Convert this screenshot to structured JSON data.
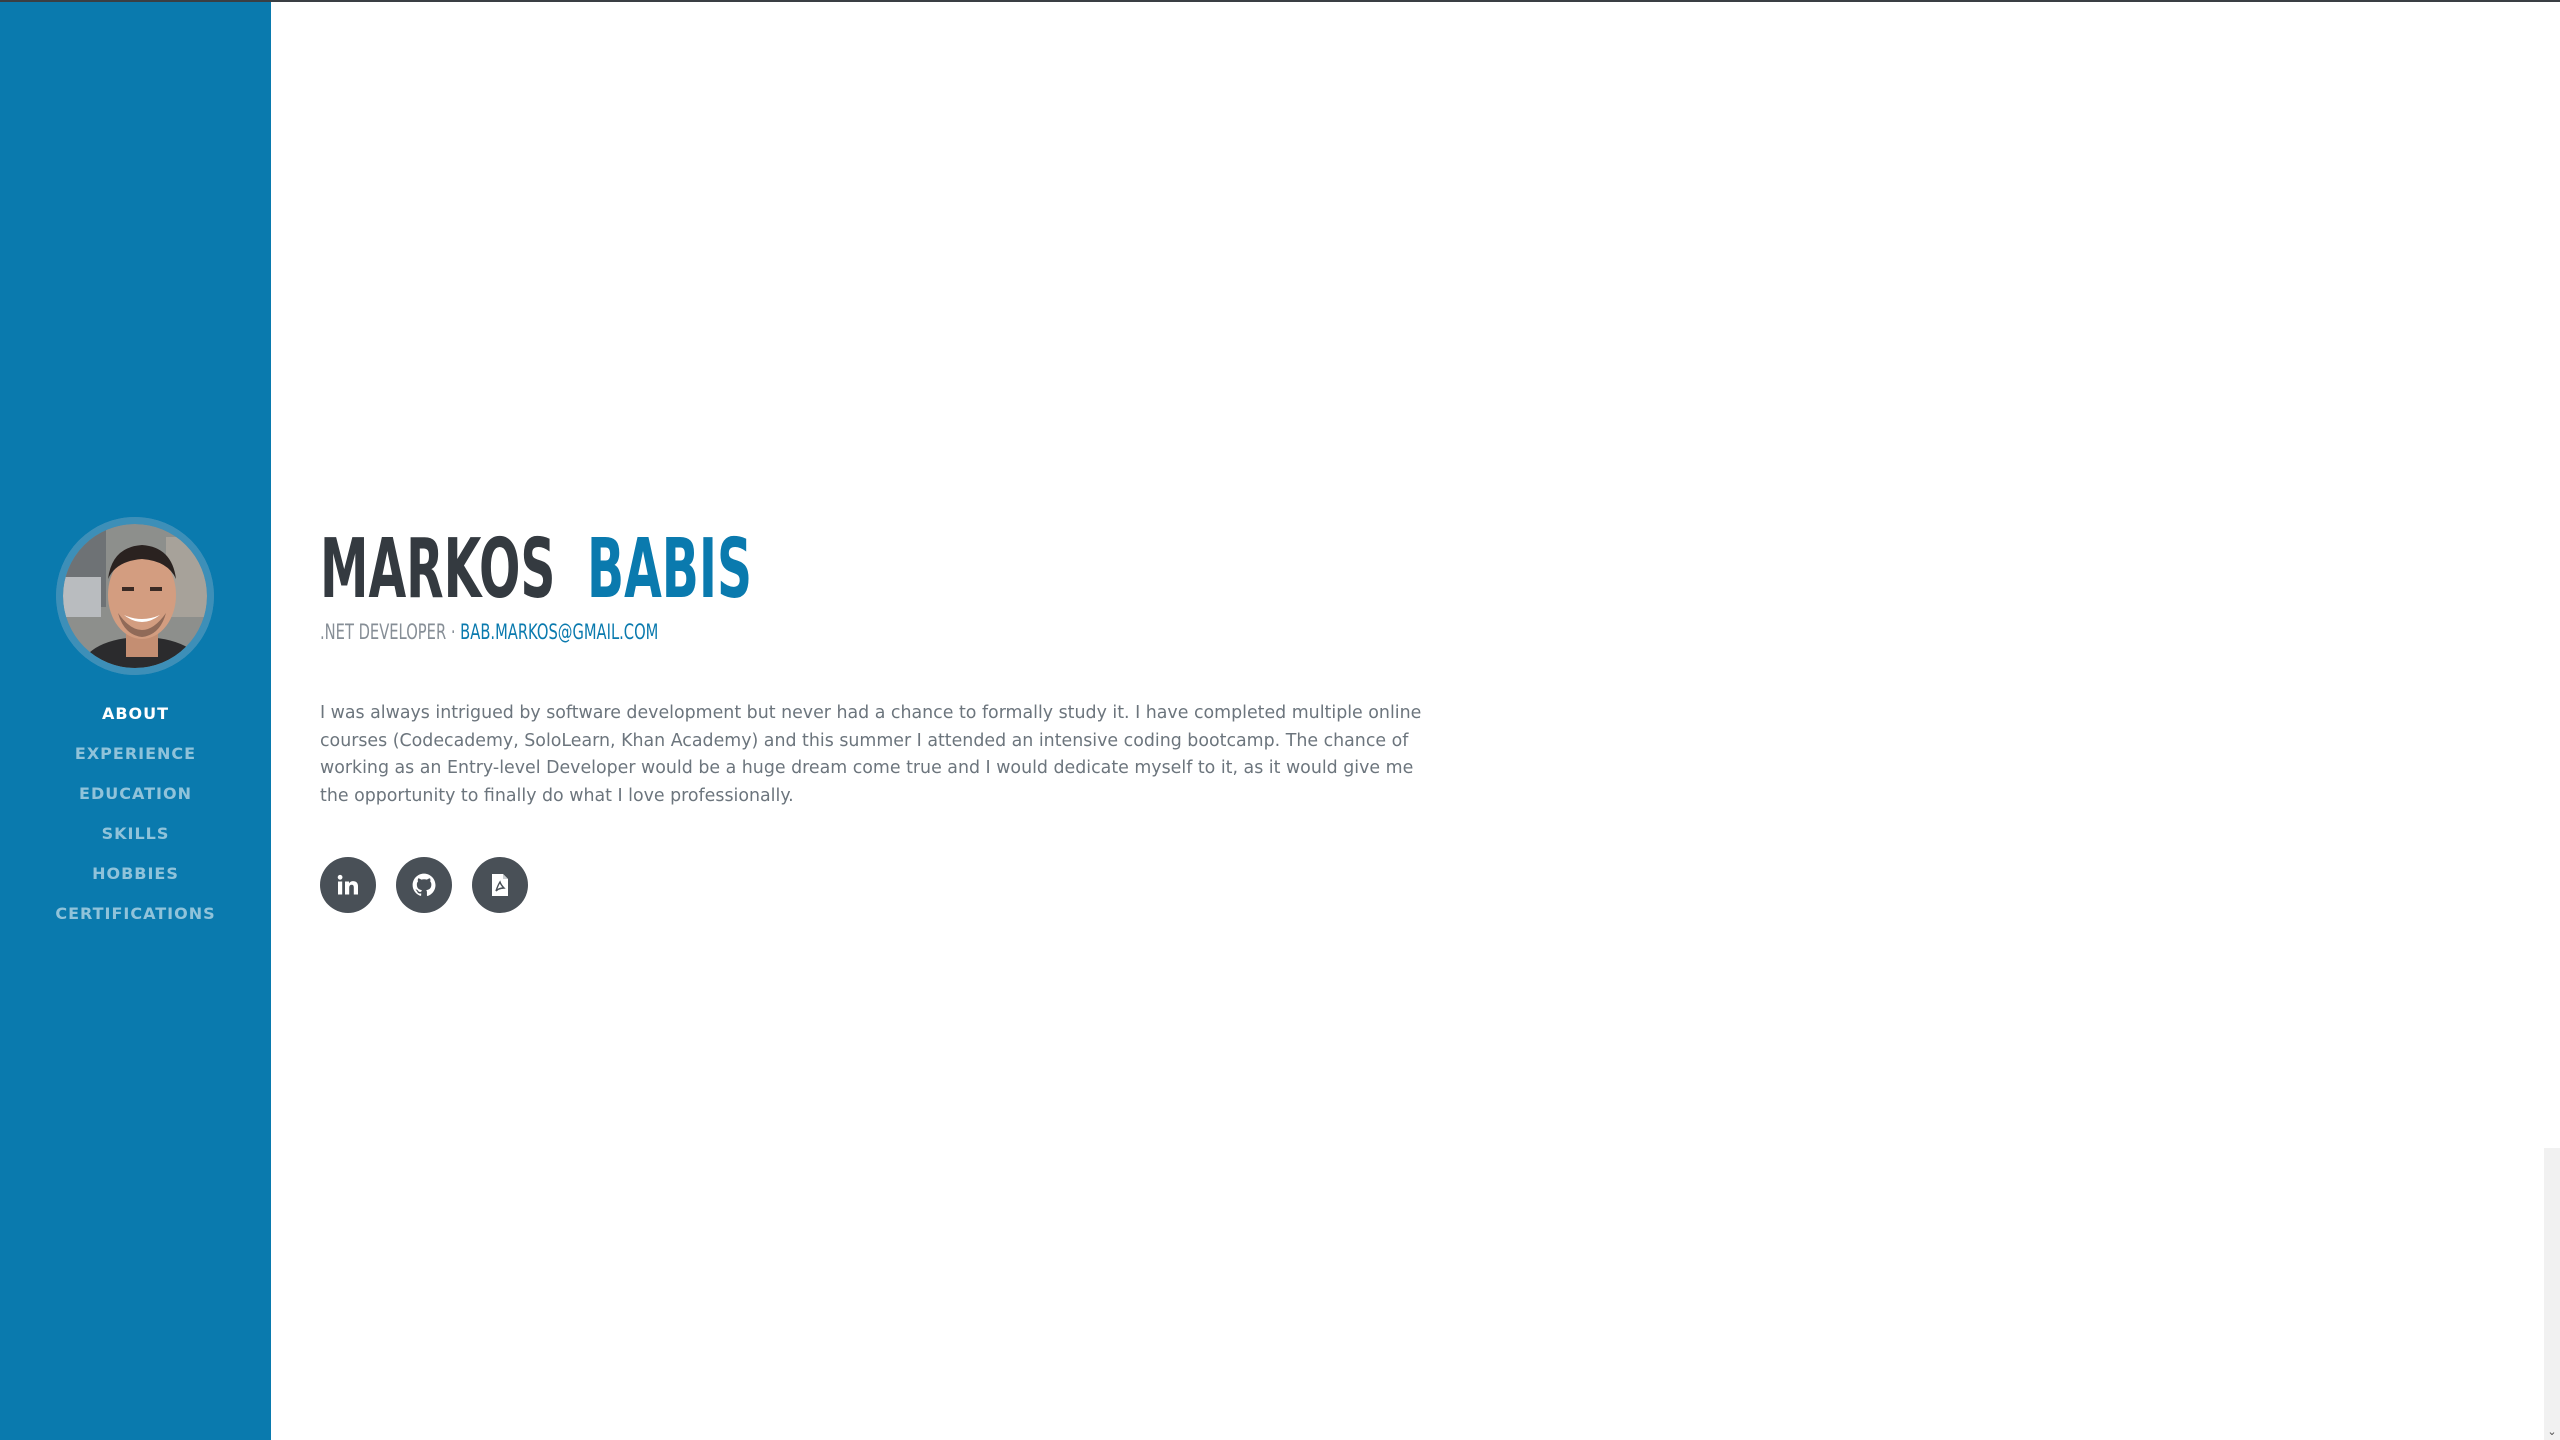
{
  "sidebar": {
    "background": "#0a7aae",
    "nav": [
      {
        "label": "ABOUT",
        "active": true
      },
      {
        "label": "EXPERIENCE",
        "active": false
      },
      {
        "label": "EDUCATION",
        "active": false
      },
      {
        "label": "SKILLS",
        "active": false
      },
      {
        "label": "HOBBIES",
        "active": false
      },
      {
        "label": "CERTIFICATIONS",
        "active": false
      }
    ]
  },
  "about": {
    "first_name": "MARKOS",
    "last_name": "BABIS",
    "role": ".NET DEVELOPER",
    "separator": " · ",
    "email": "BAB.MARKOS@GMAIL.COM",
    "description": "I was always intrigued by software development but  never had a chance to formally study it. I have  completed multiple online courses (Codecademy,  SoloLearn, Khan Academy) and this summer I attended an intensive coding bootcamp. The chance of working as an Entry-level Developer  would be a huge dream come true and I would  dedicate myself to it, as it would give me the opportunity to finally do what I love professionally."
  },
  "social": [
    {
      "icon": "linkedin-icon"
    },
    {
      "icon": "github-icon"
    },
    {
      "icon": "pdf-file-icon"
    }
  ],
  "colors": {
    "accent": "#0a7aae",
    "heading": "#343a40",
    "text": "#6c757d",
    "social_bg": "#495057"
  }
}
